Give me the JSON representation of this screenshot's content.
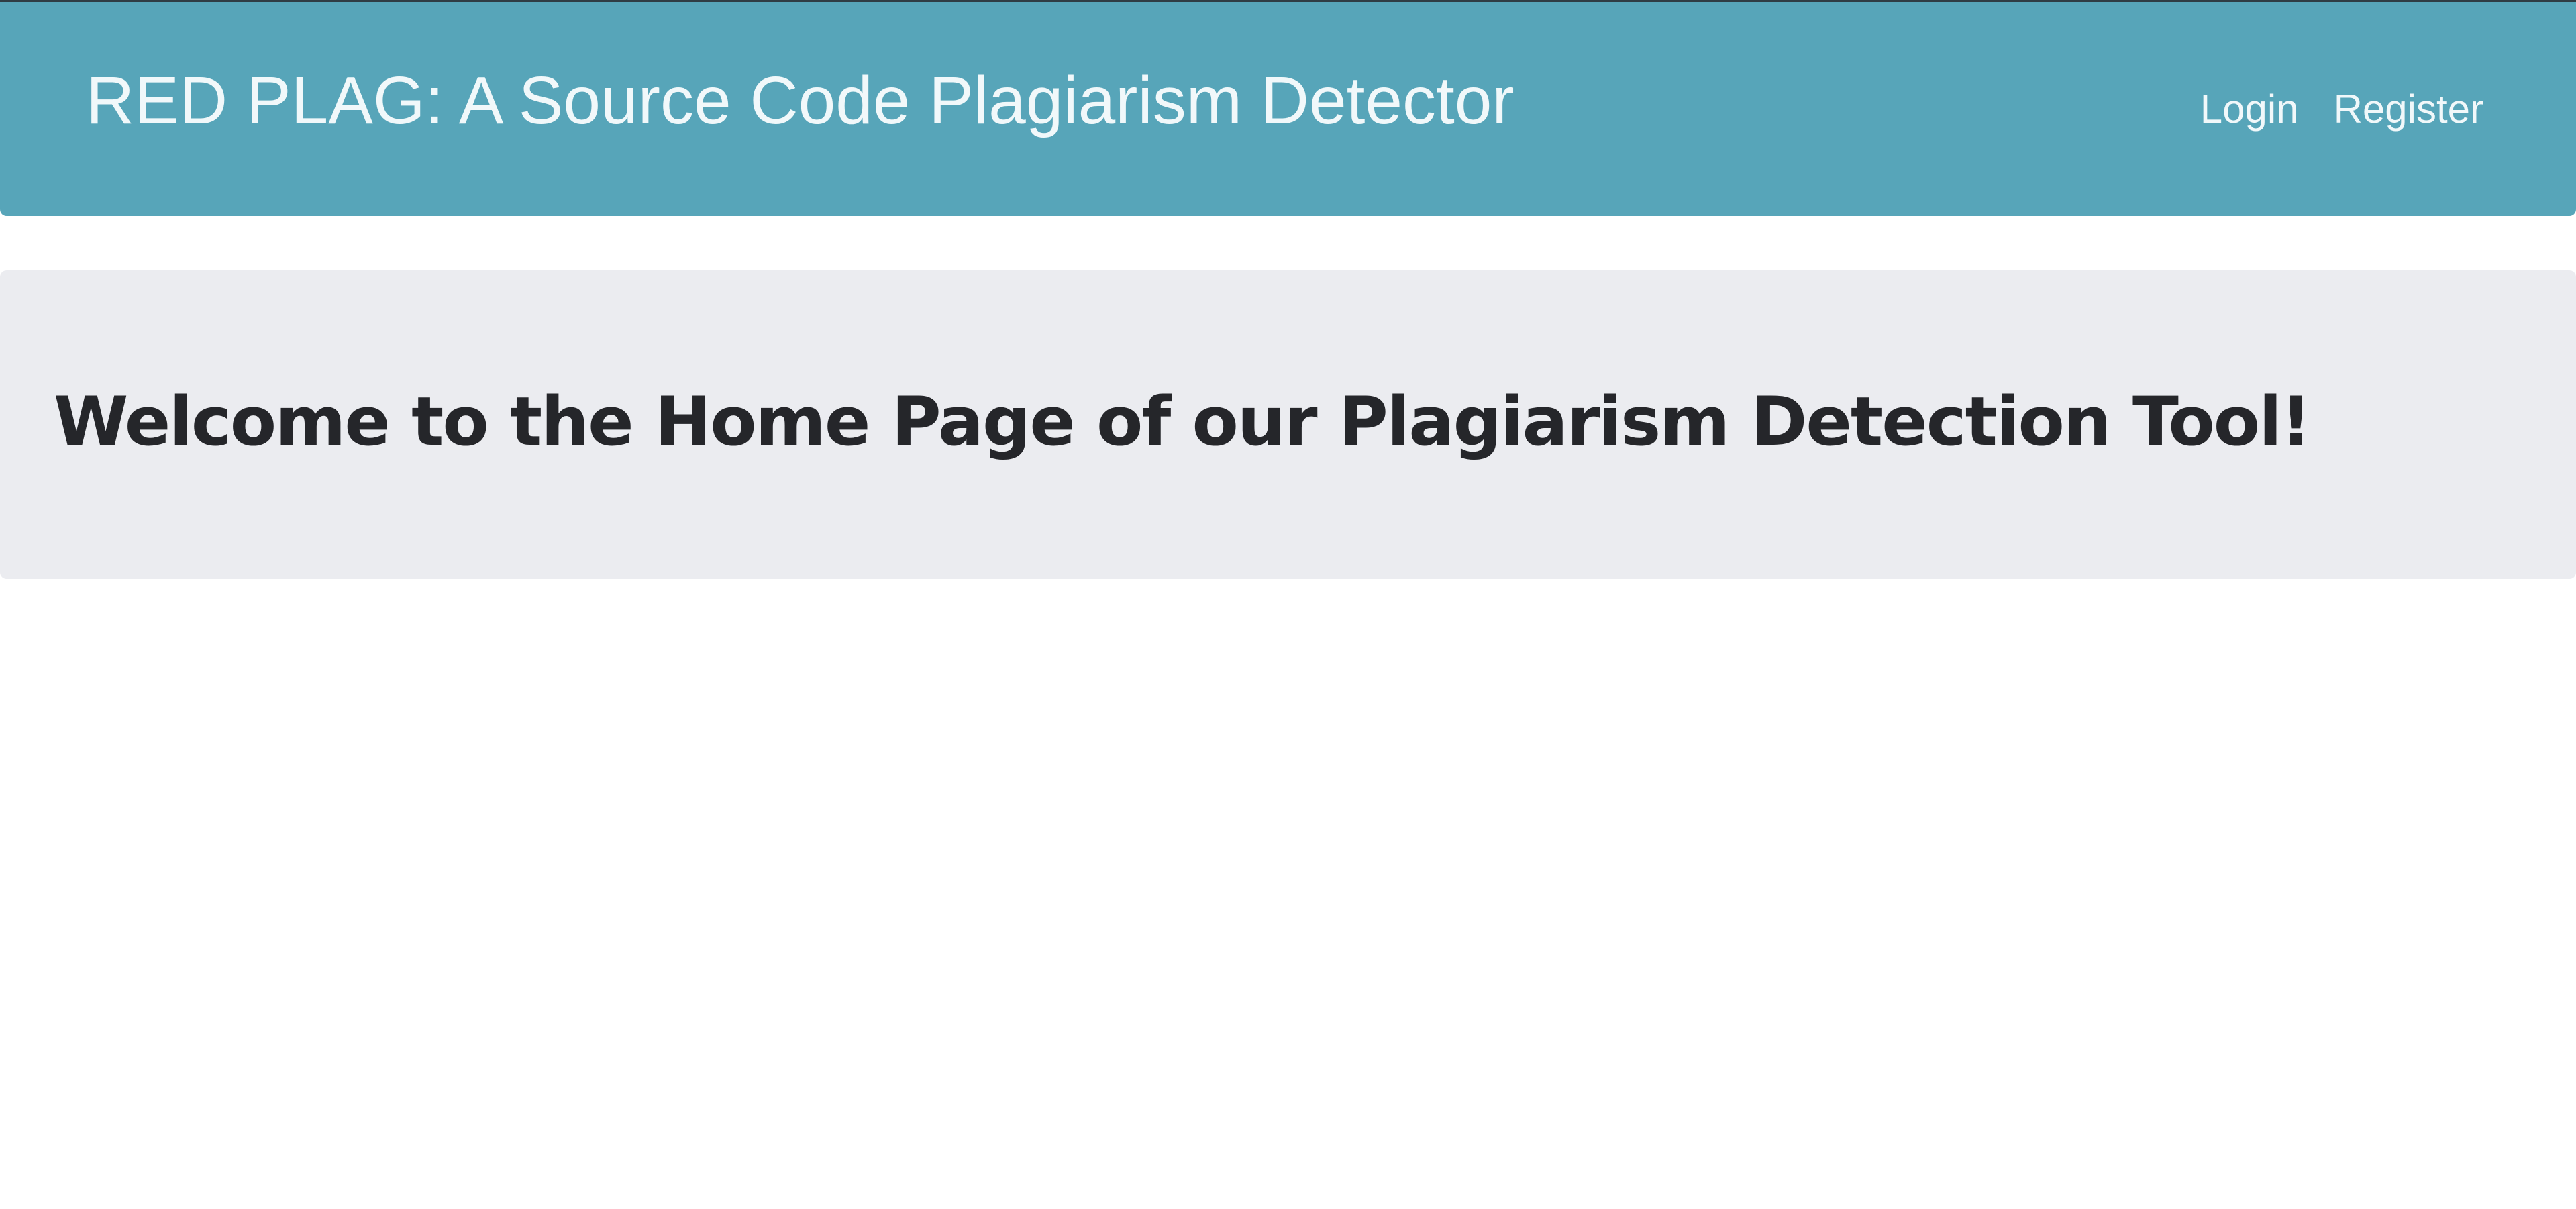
{
  "navbar": {
    "brand": "RED PLAG: A Source Code Plagiarism Detector",
    "links": [
      {
        "label": "Login"
      },
      {
        "label": "Register"
      }
    ]
  },
  "main": {
    "welcome_heading": "Welcome to the Home Page of our Plagiarism Detection Tool!"
  },
  "colors": {
    "navbar_background": "#57a5b9",
    "navbar_text": "#f1f8fa",
    "jumbotron_background": "#ebecf0",
    "heading_text": "#25262a"
  }
}
